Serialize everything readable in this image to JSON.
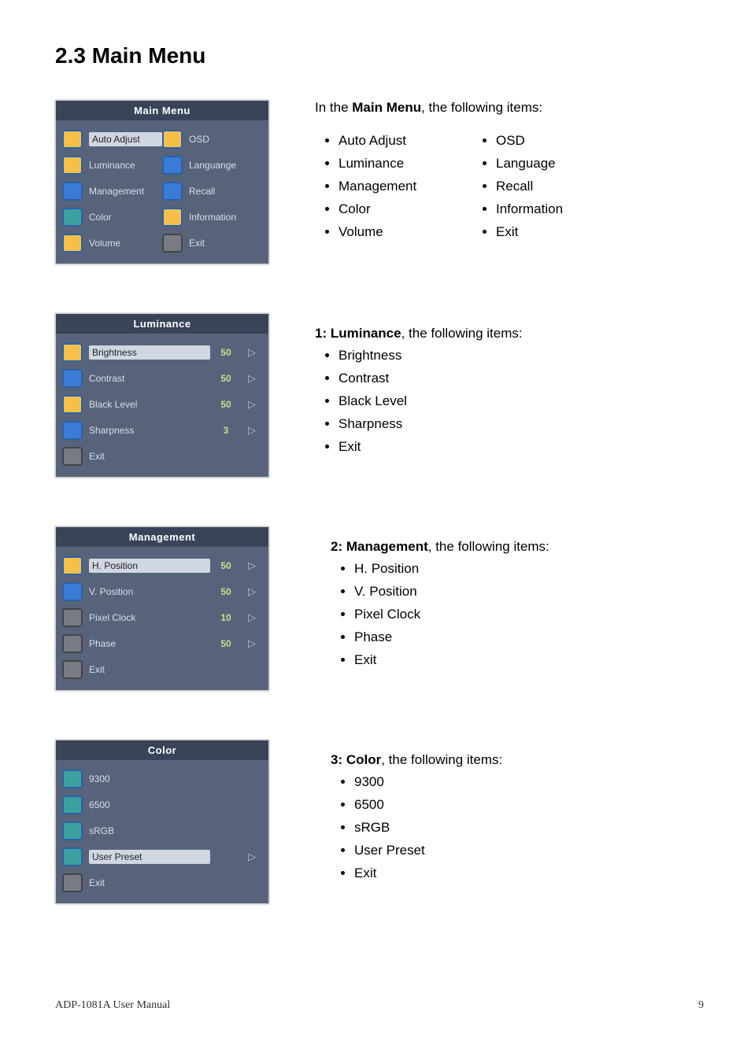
{
  "heading": "2.3 Main Menu",
  "mainMenu": {
    "title": "Main Menu",
    "rows": [
      {
        "leftIcon": "auto-icon",
        "leftIconClass": "",
        "leftLabel": "Auto Adjust",
        "leftSelected": true,
        "rightIcon": "osd-icon",
        "rightIconClass": "",
        "rightLabel": "OSD"
      },
      {
        "leftIcon": "lum-icon",
        "leftIconClass": "",
        "leftLabel": "Luminance",
        "leftSelected": false,
        "rightIcon": "lang-icon",
        "rightIconClass": "blue",
        "rightLabel": "Languange"
      },
      {
        "leftIcon": "mgmt-icon",
        "leftIconClass": "blue",
        "leftLabel": "Management",
        "leftSelected": false,
        "rightIcon": "recall-icon",
        "rightIconClass": "blue",
        "rightLabel": "Recall"
      },
      {
        "leftIcon": "color-icon",
        "leftIconClass": "teal",
        "leftLabel": "Color",
        "leftSelected": false,
        "rightIcon": "info-icon",
        "rightIconClass": "",
        "rightLabel": "Information"
      },
      {
        "leftIcon": "vol-icon",
        "leftIconClass": "",
        "leftLabel": "Volume",
        "leftSelected": false,
        "rightIcon": "exit-icon",
        "rightIconClass": "gray",
        "rightLabel": "Exit"
      }
    ]
  },
  "mainMenuText": {
    "introPrefix": "In the ",
    "introBold": "Main Menu",
    "introSuffix": ", the following items:",
    "itemsLeft": [
      "Auto Adjust",
      "Luminance",
      "Management",
      "Color",
      "Volume"
    ],
    "itemsRight": [
      "OSD",
      "Language",
      "Recall",
      "Information",
      "Exit"
    ]
  },
  "luminance": {
    "title": "Luminance",
    "rows": [
      {
        "icon": "bright-icon",
        "iconClass": "",
        "label": "Brightness",
        "selected": true,
        "value": "50",
        "arrow": "▷"
      },
      {
        "icon": "contrast-icon",
        "iconClass": "blue",
        "label": "Contrast",
        "selected": false,
        "value": "50",
        "arrow": "▷"
      },
      {
        "icon": "blacklevel-icon",
        "iconClass": "",
        "label": "Black Level",
        "selected": false,
        "value": "50",
        "arrow": "▷"
      },
      {
        "icon": "sharp-icon",
        "iconClass": "blue",
        "label": "Sharpness",
        "selected": false,
        "value": "3",
        "arrow": "▷"
      },
      {
        "icon": "exit-icon",
        "iconClass": "gray",
        "label": "Exit",
        "selected": false,
        "value": "",
        "arrow": ""
      }
    ]
  },
  "luminanceText": {
    "introPrefix": "1: ",
    "introBold": "Luminance",
    "introSuffix": ", the following items:",
    "items": [
      "Brightness",
      "Contrast",
      "Black Level",
      "Sharpness",
      "Exit"
    ]
  },
  "management": {
    "title": "Management",
    "rows": [
      {
        "icon": "hpos-icon",
        "iconClass": "",
        "label": "H. Position",
        "selected": true,
        "value": "50",
        "arrow": "▷"
      },
      {
        "icon": "vpos-icon",
        "iconClass": "blue",
        "label": "V. Position",
        "selected": false,
        "value": "50",
        "arrow": "▷"
      },
      {
        "icon": "clock-icon",
        "iconClass": "gray",
        "label": "Pixel Clock",
        "selected": false,
        "value": "10",
        "arrow": "▷"
      },
      {
        "icon": "phase-icon",
        "iconClass": "gray",
        "label": "Phase",
        "selected": false,
        "value": "50",
        "arrow": "▷"
      },
      {
        "icon": "exit-icon",
        "iconClass": "gray",
        "label": "Exit",
        "selected": false,
        "value": "",
        "arrow": ""
      }
    ]
  },
  "managementText": {
    "introPrefix": "2: ",
    "introBold": "Management",
    "introSuffix": ", the following items:",
    "items": [
      "H. Position",
      "V. Position",
      "Pixel Clock",
      "Phase",
      "Exit"
    ]
  },
  "color": {
    "title": "Color",
    "rows": [
      {
        "icon": "c1-icon",
        "iconClass": "teal",
        "label": "9300",
        "selected": false,
        "value": "",
        "arrow": ""
      },
      {
        "icon": "c2-icon",
        "iconClass": "teal",
        "label": "6500",
        "selected": false,
        "value": "",
        "arrow": ""
      },
      {
        "icon": "c3-icon",
        "iconClass": "teal",
        "label": "sRGB",
        "selected": false,
        "value": "",
        "arrow": ""
      },
      {
        "icon": "c4-icon",
        "iconClass": "teal",
        "label": "User Preset",
        "selected": true,
        "value": "",
        "arrow": "▷"
      },
      {
        "icon": "exit-icon",
        "iconClass": "gray",
        "label": "Exit",
        "selected": false,
        "value": "",
        "arrow": ""
      }
    ]
  },
  "colorText": {
    "introPrefix": "3: ",
    "introBold": "Color",
    "introSuffix": ", the following items:",
    "items": [
      "9300",
      "6500",
      "sRGB",
      "User Preset",
      "Exit"
    ]
  },
  "footer": {
    "left": "ADP-1081A User Manual",
    "right": "9"
  }
}
